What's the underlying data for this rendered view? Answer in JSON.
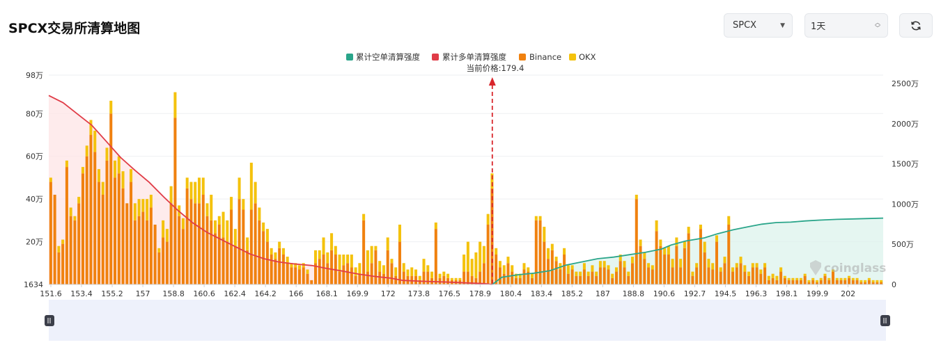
{
  "title": "SPCX交易所清算地图",
  "controls": {
    "symbol": "SPCX",
    "interval": "1天",
    "caret_icon": "chevron-down-icon",
    "updown_icon": "updown-icon",
    "refresh_icon": "refresh-icon"
  },
  "watermark": "coinglass",
  "colors": {
    "binance": "#f0810f",
    "okx": "#f4c20d",
    "long": "#e03c47",
    "short": "#2aa58a",
    "long_fill": "#fde4e6",
    "short_fill": "#dcf3ec",
    "slider_bg": "#eef1fb"
  },
  "chart_data": {
    "type": "bar",
    "legend": [
      "累计空单清算强度",
      "累计多单清算强度",
      "Binance",
      "OKX"
    ],
    "legend_position": "top-center",
    "current_price_label": "当前价格:179.4",
    "current_price": 179.4,
    "y_left": {
      "ticks": [
        "1634",
        "20万",
        "40万",
        "60万",
        "80万",
        "98万"
      ],
      "min": 1634,
      "max": 980000
    },
    "y_right": {
      "ticks": [
        "0",
        "500万",
        "1000万",
        "1500万",
        "2000万",
        "2500万"
      ],
      "min": 0,
      "max": 25000000
    },
    "x_ticks": [
      "151.6",
      "153.4",
      "155.2",
      "157",
      "158.8",
      "160.6",
      "162.4",
      "164.2",
      "166",
      "168.1",
      "169.9",
      "172",
      "173.8",
      "176.5",
      "178.9",
      "180.4",
      "183.4",
      "185.2",
      "187",
      "188.8",
      "190.6",
      "192.7",
      "194.5",
      "196.3",
      "198.1",
      "199.9",
      "202"
    ],
    "x_range": [
      151.6,
      203.9
    ],
    "binance": [
      48,
      42,
      15,
      19,
      55,
      32,
      30,
      38,
      52,
      60,
      70,
      62,
      48,
      42,
      58,
      80,
      50,
      52,
      45,
      38,
      48,
      30,
      32,
      34,
      30,
      36,
      28,
      15,
      22,
      20,
      38,
      78,
      32,
      26,
      45,
      40,
      38,
      38,
      42,
      32,
      30,
      24,
      28,
      22,
      20,
      35,
      18,
      40,
      35,
      16,
      35,
      38,
      30,
      25,
      20,
      14,
      12,
      17,
      14,
      10,
      8,
      8,
      7,
      8,
      5,
      2,
      10,
      12,
      14,
      10,
      16,
      14,
      6,
      9,
      10,
      8,
      4,
      5,
      30,
      6,
      10,
      16,
      6,
      5,
      16,
      10,
      4,
      20,
      6,
      4,
      4,
      4,
      2,
      6,
      6,
      3,
      26,
      3,
      4,
      3,
      2,
      2,
      2,
      6,
      6,
      4,
      3,
      6,
      10,
      28,
      45,
      14,
      8,
      5,
      10,
      6,
      3,
      3,
      7,
      6,
      3,
      30,
      30,
      20,
      12,
      16,
      11,
      7,
      14,
      5,
      7,
      4,
      4,
      7,
      4,
      6,
      4,
      8,
      8,
      7,
      3,
      6,
      11,
      8,
      4,
      10,
      40,
      18,
      12,
      8,
      7,
      25,
      18,
      14,
      14,
      8,
      18,
      8,
      17,
      24,
      4,
      8,
      26,
      15,
      8,
      7,
      20,
      6,
      10,
      28,
      6,
      8,
      10,
      6,
      4,
      8,
      8,
      5,
      8,
      2,
      3,
      2,
      6,
      3,
      2,
      2,
      2,
      2,
      4,
      1,
      2,
      1,
      2,
      4,
      2,
      6,
      2,
      2,
      2,
      3,
      2,
      2,
      1,
      1,
      2,
      1,
      1,
      1
    ],
    "okx": [
      2,
      0,
      3,
      2,
      3,
      4,
      2,
      3,
      3,
      5,
      7,
      10,
      6,
      6,
      6,
      6,
      8,
      8,
      8,
      0,
      6,
      8,
      8,
      6,
      10,
      6,
      0,
      2,
      8,
      6,
      8,
      12,
      5,
      5,
      5,
      8,
      10,
      12,
      8,
      6,
      12,
      6,
      4,
      12,
      10,
      6,
      8,
      10,
      5,
      6,
      22,
      10,
      6,
      4,
      6,
      3,
      3,
      3,
      3,
      3,
      2,
      2,
      2,
      2,
      2,
      0,
      6,
      4,
      8,
      5,
      8,
      4,
      8,
      5,
      4,
      6,
      4,
      5,
      3,
      10,
      8,
      2,
      5,
      4,
      6,
      2,
      4,
      8,
      4,
      3,
      4,
      3,
      2,
      6,
      3,
      3,
      3,
      2,
      2,
      2,
      1,
      1,
      1,
      8,
      14,
      8,
      12,
      14,
      8,
      5,
      7,
      3,
      3,
      4,
      3,
      3,
      2,
      2,
      3,
      2,
      2,
      2,
      2,
      7,
      5,
      3,
      2,
      3,
      3,
      4,
      2,
      2,
      2,
      3,
      2,
      3,
      2,
      3,
      3,
      2,
      2,
      2,
      3,
      3,
      2,
      3,
      2,
      3,
      3,
      2,
      2,
      5,
      3,
      3,
      4,
      4,
      4,
      4,
      3,
      3,
      2,
      2,
      2,
      5,
      4,
      3,
      3,
      2,
      3,
      4,
      2,
      2,
      3,
      3,
      2,
      2,
      2,
      2,
      2,
      2,
      2,
      2,
      2,
      1,
      1,
      1,
      1,
      1,
      1,
      1,
      1,
      1,
      1,
      1,
      1,
      1,
      1,
      1,
      1,
      1,
      1,
      1,
      1,
      1,
      1,
      1,
      1,
      1
    ],
    "long_cumulative": {
      "x": [
        151.6,
        152.5,
        153.4,
        154.3,
        155.2,
        156.1,
        157,
        157.9,
        158.8,
        159.7,
        160.6,
        161.5,
        162.4,
        163.3,
        164.2,
        165.1,
        166,
        167,
        168.1,
        169,
        169.9,
        171,
        172,
        173,
        173.8,
        175,
        176.5,
        177.7,
        178.9,
        179.4
      ],
      "y": [
        2350,
        2260,
        2120,
        1980,
        1780,
        1580,
        1420,
        1270,
        1090,
        920,
        770,
        650,
        560,
        470,
        380,
        320,
        280,
        255,
        235,
        200,
        170,
        130,
        100,
        80,
        50,
        40,
        30,
        20,
        10,
        0
      ],
      "unit": "万"
    },
    "short_cumulative": {
      "x": [
        179.4,
        180,
        181,
        182,
        183,
        184,
        185,
        186,
        187,
        188,
        189,
        190,
        190.6,
        191.5,
        192.7,
        193.5,
        194.5,
        195.5,
        196.3,
        197.2,
        198.1,
        199,
        199.9,
        201,
        202,
        203,
        203.9
      ],
      "y": [
        0,
        90,
        120,
        140,
        170,
        240,
        280,
        320,
        340,
        370,
        400,
        440,
        490,
        540,
        580,
        630,
        680,
        720,
        750,
        770,
        775,
        790,
        800,
        810,
        815,
        820,
        825
      ],
      "unit": "万"
    }
  }
}
